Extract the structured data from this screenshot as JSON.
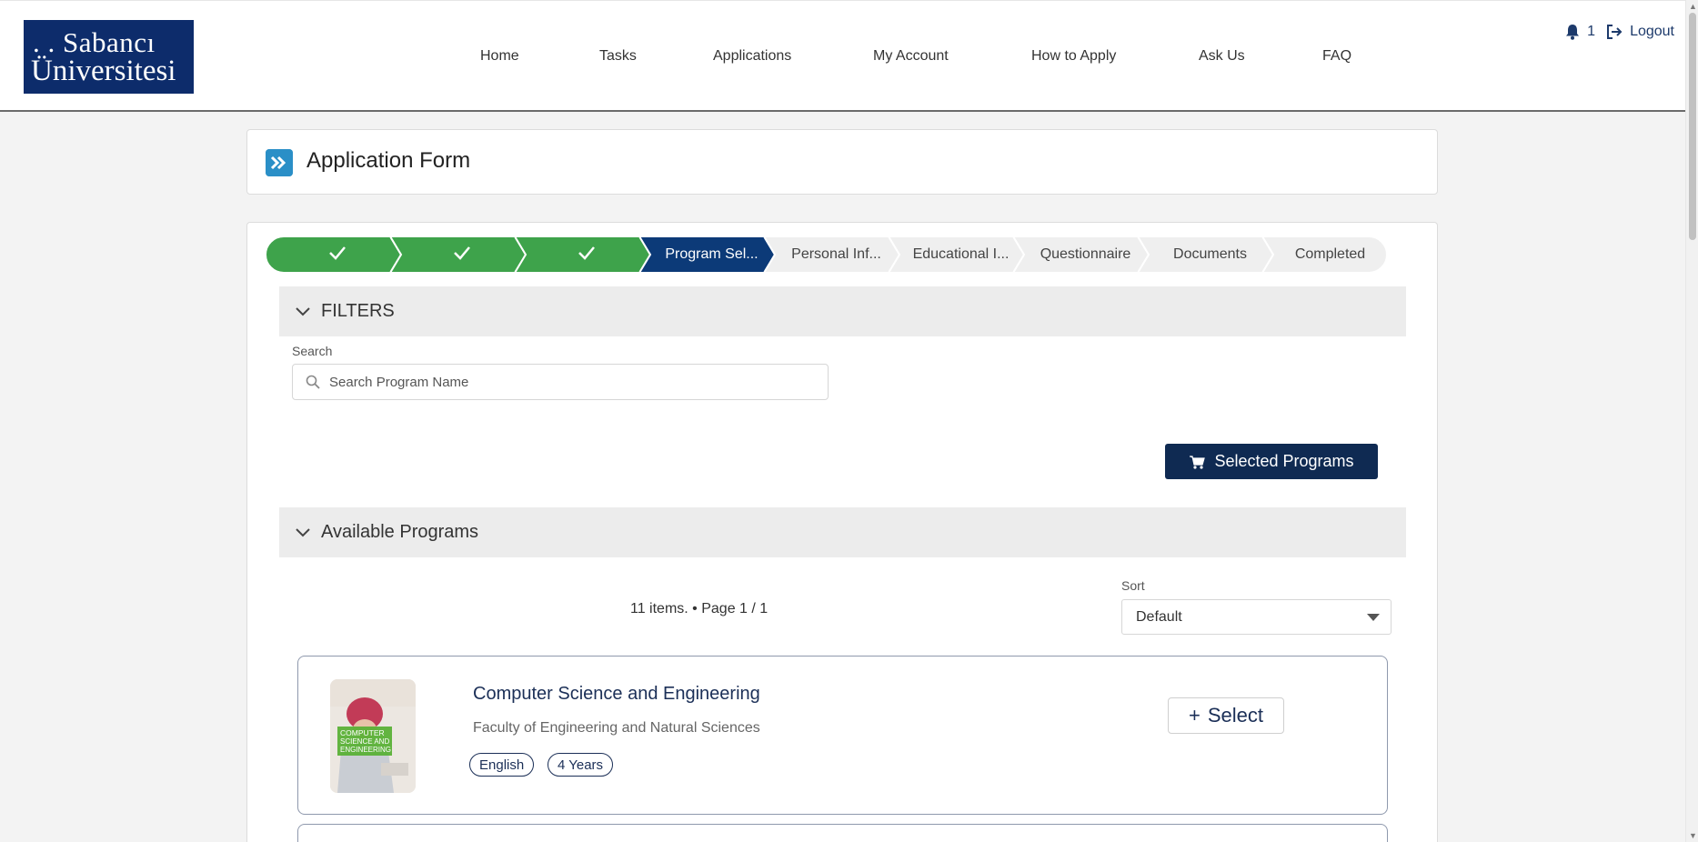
{
  "header": {
    "logo": {
      "line1": ". . Sabancı",
      "line2": "Üniversitesi"
    },
    "nav": [
      {
        "label": "Home"
      },
      {
        "label": "Tasks"
      },
      {
        "label": "Applications"
      },
      {
        "label": "My Account"
      },
      {
        "label": "How to Apply"
      },
      {
        "label": "Ask Us"
      },
      {
        "label": "FAQ"
      }
    ],
    "notifications_count": "1",
    "logout_label": "Logout"
  },
  "page": {
    "title": "Application Form"
  },
  "stepper": {
    "steps": [
      {
        "label": "",
        "state": "done"
      },
      {
        "label": "",
        "state": "done"
      },
      {
        "label": "",
        "state": "done"
      },
      {
        "label": "Program Sel...",
        "state": "current"
      },
      {
        "label": "Personal Inf...",
        "state": "todo"
      },
      {
        "label": "Educational I...",
        "state": "todo"
      },
      {
        "label": "Questionnaire",
        "state": "todo"
      },
      {
        "label": "Documents",
        "state": "todo"
      },
      {
        "label": "Completed",
        "state": "todo"
      }
    ],
    "colors": {
      "done": "#3ea34b",
      "current": "#0c3a78",
      "todo": "#efefef"
    }
  },
  "filters": {
    "title": "FILTERS",
    "search_label": "Search",
    "search_placeholder": "Search Program Name",
    "search_value": ""
  },
  "selected_programs_label": "Selected Programs",
  "available": {
    "title": "Available Programs",
    "items_info": "11 items. • Page 1 / 1",
    "sort_label": "Sort",
    "sort_value": "Default"
  },
  "programs": [
    {
      "title": "Computer Science and Engineering",
      "faculty": "Faculty of Engineering and Natural Sciences",
      "tags": [
        "English",
        "4 Years"
      ],
      "thumb_caption": [
        "COMPUTER",
        "SCIENCE AND",
        "ENGINEERING"
      ],
      "select_label": "Select"
    }
  ],
  "colors": {
    "brand": "#0d2c6b",
    "button": "#0f2a52",
    "accent": "#2a8fc7"
  }
}
